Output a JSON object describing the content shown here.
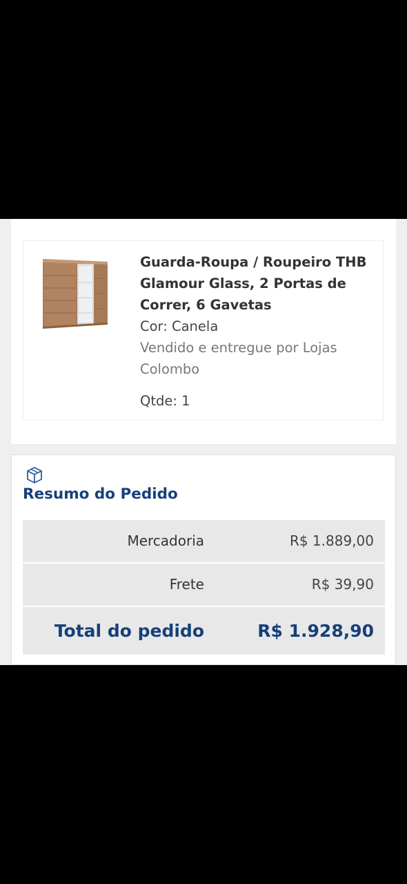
{
  "product": {
    "title": "Guarda-Roupa / Roupeiro THB Glamour Glass, 2 Portas de Correr, 6 Gavetas",
    "color": "Cor: Canela",
    "seller": "Vendido e entregue por Lojas Colombo",
    "quantity": "Qtde: 1",
    "image_icon": "wardrobe-image"
  },
  "summary": {
    "icon": "package-icon",
    "title": "Resumo do Pedido",
    "rows": [
      {
        "label": "Mercadoria",
        "value": "R$ 1.889,00"
      },
      {
        "label": "Frete",
        "value": "R$ 39,90"
      }
    ],
    "total": {
      "label": "Total do pedido",
      "value": "R$ 1.928,90"
    }
  },
  "colors": {
    "brand_blue": "#16407a",
    "row_background": "#e8e8e8",
    "page_background": "#efefef"
  }
}
